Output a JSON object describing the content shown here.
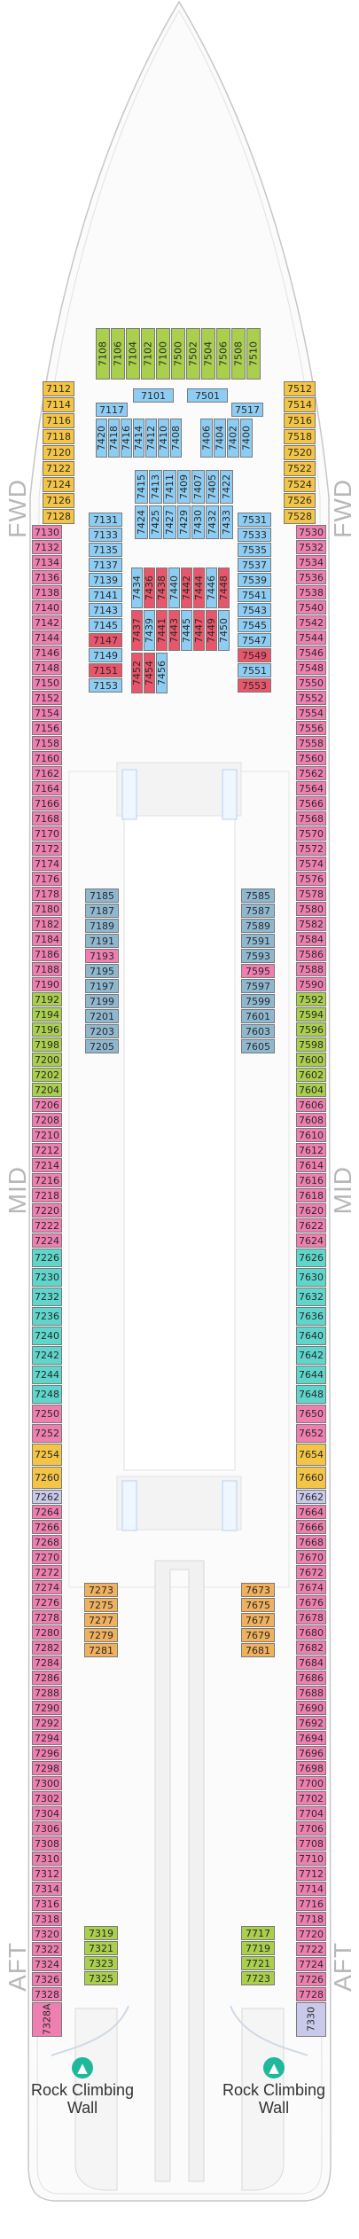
{
  "deck_labels": {
    "fwd": "FWD",
    "mid": "MID",
    "aft": "AFT"
  },
  "landmarks": {
    "rock_climbing_wall": "Rock Climbing Wall"
  },
  "icons": {
    "rock_climbing": "rock-climbing-icon"
  },
  "colors": {
    "pink": "#ef7fb0",
    "blue": "#8ecdf3",
    "teal": "#5fd6cc",
    "gold": "#f3c445",
    "orange": "#f0b15f",
    "green": "#a9cf4c",
    "red": "#e9566b"
  },
  "cabins": {
    "port_outer": [
      "7112",
      "7114",
      "7116",
      "7118",
      "7120",
      "7122",
      "7124",
      "7126",
      "7128",
      "7130",
      "7132",
      "7134",
      "7136",
      "7138",
      "7140",
      "7142",
      "7144",
      "7146",
      "7148",
      "7150",
      "7152",
      "7154",
      "7156",
      "7158",
      "7160",
      "7162",
      "7164",
      "7166",
      "7168",
      "7170",
      "7172",
      "7174",
      "7176",
      "7178",
      "7180",
      "7182",
      "7184",
      "7186",
      "7188",
      "7190",
      "7192",
      "7194",
      "7196",
      "7198",
      "7200",
      "7202",
      "7204",
      "7206",
      "7208",
      "7210",
      "7212",
      "7214",
      "7216",
      "7218",
      "7220",
      "7222",
      "7224",
      "7226",
      "7230",
      "7232",
      "7236",
      "7240",
      "7242",
      "7244",
      "7248",
      "7250",
      "7252",
      "7254",
      "7260",
      "7262",
      "7264",
      "7266",
      "7268",
      "7270",
      "7272",
      "7274",
      "7276",
      "7278",
      "7280",
      "7282",
      "7284",
      "7286",
      "7288",
      "7290",
      "7292",
      "7294",
      "7296",
      "7298",
      "7300",
      "7302",
      "7304",
      "7306",
      "7308",
      "7310",
      "7312",
      "7314",
      "7316",
      "7318",
      "7320",
      "7322",
      "7324",
      "7326",
      "7328",
      "7328A"
    ],
    "starboard_outer": [
      "7512",
      "7514",
      "7516",
      "7518",
      "7520",
      "7522",
      "7524",
      "7526",
      "7528",
      "7530",
      "7532",
      "7534",
      "7536",
      "7538",
      "7540",
      "7542",
      "7544",
      "7546",
      "7548",
      "7550",
      "7552",
      "7554",
      "7556",
      "7558",
      "7560",
      "7562",
      "7564",
      "7566",
      "7568",
      "7570",
      "7572",
      "7574",
      "7576",
      "7578",
      "7580",
      "7582",
      "7584",
      "7586",
      "7588",
      "7590",
      "7592",
      "7594",
      "7596",
      "7598",
      "7600",
      "7602",
      "7604",
      "7606",
      "7608",
      "7610",
      "7612",
      "7614",
      "7616",
      "7618",
      "7620",
      "7622",
      "7624",
      "7626",
      "7630",
      "7632",
      "7636",
      "7640",
      "7642",
      "7644",
      "7648",
      "7650",
      "7652",
      "7654",
      "7660",
      "7662",
      "7664",
      "7666",
      "7668",
      "7670",
      "7672",
      "7674",
      "7676",
      "7678",
      "7680",
      "7682",
      "7684",
      "7686",
      "7688",
      "7690",
      "7692",
      "7694",
      "7696",
      "7698",
      "7700",
      "7702",
      "7704",
      "7706",
      "7708",
      "7710",
      "7712",
      "7714",
      "7716",
      "7718",
      "7720",
      "7722",
      "7724",
      "7726",
      "7728",
      "7330"
    ],
    "fwd_top": [
      "7108",
      "7106",
      "7104",
      "7102",
      "7100",
      "7500",
      "7502",
      "7504",
      "7506",
      "7508",
      "7510"
    ],
    "fwd_port_inner_top": [
      "7101",
      "7117"
    ],
    "fwd_stbd_inner_top": [
      "7501",
      "7517"
    ],
    "fwd_vertical_port": [
      "7420",
      "7418",
      "7416",
      "7414",
      "7412",
      "7410",
      "7408"
    ],
    "fwd_vertical_stbd": [
      "7406",
      "7404",
      "7402",
      "7400"
    ],
    "fwd_center_blue": [
      "7415",
      "7413",
      "7411",
      "7409",
      "7407",
      "7405",
      "7422",
      "7424",
      "7425",
      "7427",
      "7429",
      "7430",
      "7432",
      "7433"
    ],
    "fwd_port_inner_list": [
      "7131",
      "7133",
      "7135",
      "7137",
      "7139",
      "7141",
      "7143",
      "7145",
      "7147",
      "7149",
      "7151",
      "7153"
    ],
    "fwd_stbd_inner_list": [
      "7531",
      "7533",
      "7535",
      "7537",
      "7539",
      "7541",
      "7543",
      "7545",
      "7547",
      "7549",
      "7551",
      "7553"
    ],
    "fwd_center_lower": [
      "7434",
      "7436",
      "7438",
      "7440",
      "7442",
      "7444",
      "7446",
      "7448",
      "7437",
      "7439",
      "7441",
      "7443",
      "7445",
      "7447",
      "7449",
      "7450",
      "7452",
      "7454",
      "7456"
    ],
    "mid_port_inner": [
      "7185",
      "7187",
      "7189",
      "7191",
      "7193",
      "7195",
      "7197",
      "7199",
      "7201",
      "7203",
      "7205"
    ],
    "mid_stbd_inner": [
      "7585",
      "7587",
      "7589",
      "7591",
      "7593",
      "7595",
      "7597",
      "7599",
      "7601",
      "7603",
      "7605"
    ],
    "aft_port_inner_a": [
      "7273",
      "7275",
      "7277",
      "7279",
      "7281"
    ],
    "aft_stbd_inner_a": [
      "7673",
      "7675",
      "7677",
      "7679",
      "7681"
    ],
    "aft_port_inner_b": [
      "7319",
      "7321",
      "7323",
      "7325"
    ],
    "aft_stbd_inner_b": [
      "7717",
      "7719",
      "7721",
      "7723"
    ]
  }
}
